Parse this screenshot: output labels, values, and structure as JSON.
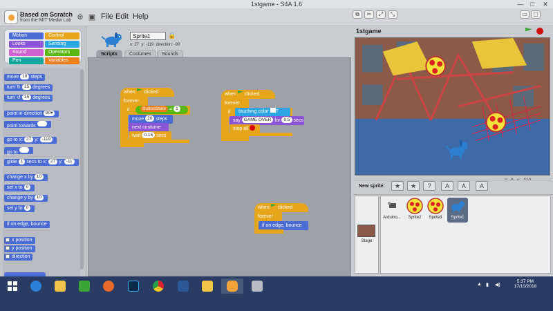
{
  "window": {
    "title": "1stgame - S4A 1.6",
    "minimize": "—",
    "maximize": "□",
    "close": "✕"
  },
  "app": {
    "brand_line1": "Based on Scratch",
    "brand_line2": "from the MIT Media Lab"
  },
  "menu": {
    "items": [
      "File",
      "Edit",
      "Help"
    ]
  },
  "categories": [
    {
      "label": "Motion",
      "color": "#4a6cd4"
    },
    {
      "label": "Control",
      "color": "#e6a51a"
    },
    {
      "label": "Looks",
      "color": "#8a55d7"
    },
    {
      "label": "Sensing",
      "color": "#2ca5e2"
    },
    {
      "label": "Sound",
      "color": "#cf63cf"
    },
    {
      "label": "Operators",
      "color": "#5cb712"
    },
    {
      "label": "Pen",
      "color": "#0fa89b"
    },
    {
      "label": "Variables",
      "color": "#ee7d16"
    }
  ],
  "palette": {
    "move_a": "move",
    "move_v": "10",
    "move_b": "steps",
    "turn_r_a": "turn ↻",
    "turn_r_v": "15",
    "turn_r_b": "degrees",
    "turn_l_a": "turn ↺",
    "turn_l_v": "15",
    "turn_l_b": "degrees",
    "point_dir_a": "point in direction",
    "point_dir_v": "90▾",
    "point_towards": "point towards",
    "goto_xy_a": "go to x:",
    "goto_xy_x": "27",
    "goto_xy_b": "y:",
    "goto_xy_y": "-119",
    "goto": "go to",
    "glide_a": "glide",
    "glide_v": "1",
    "glide_b": "secs to x:",
    "glide_x": "27",
    "glide_c": "y:",
    "glide_y": "-11",
    "change_x_a": "change x by",
    "change_x_v": "10",
    "set_x_a": "set x to",
    "set_x_v": "0",
    "change_y_a": "change y by",
    "change_y_v": "10",
    "set_y_a": "set y to",
    "set_y_v": "0",
    "bounce": "if on edge, bounce",
    "xpos": "x position",
    "ypos": "y position",
    "dir": "direction"
  },
  "sprite": {
    "name": "Sprite1",
    "x_label": "x: 27",
    "y_label": "y: -119",
    "direction_label": "direction: -90"
  },
  "tabs": [
    "Scripts",
    "Costumes",
    "Sounds"
  ],
  "script1": {
    "hat": "when",
    "hat_b": "clicked",
    "forever": "forever",
    "if": "if",
    "var": "ButtonState",
    "eq": "=",
    "eq_v": "1",
    "move_a": "move",
    "move_v": "20",
    "move_b": "steps",
    "next": "next costume",
    "wait_a": "wait",
    "wait_v": "0.15",
    "wait_b": "secs"
  },
  "script2": {
    "hat": "when",
    "hat_b": "clicked",
    "forever": "forever",
    "if": "if",
    "touching": "touching color",
    "touch_color": "#ffffff",
    "touch_q": "?",
    "say_a": "say",
    "say_v": "GAME OVER",
    "say_b": "for",
    "say_secs": "0.5",
    "say_c": "secs",
    "stop": "stop all"
  },
  "script3": {
    "hat": "when",
    "hat_b": "clicked",
    "forever": "forever",
    "bounce": "if on edge, bounce"
  },
  "stage": {
    "title": "1stgame",
    "mouse_x": "x: -8",
    "mouse_y": "y: -410"
  },
  "new_sprite": {
    "label": "New sprite:"
  },
  "sprites": [
    {
      "label": "Arduino..."
    },
    {
      "label": "Sprite2"
    },
    {
      "label": "Sprite3"
    },
    {
      "label": "Sprite1"
    }
  ],
  "stage_label": "Stage",
  "taskbar": {
    "time": "5:37 PM",
    "date": "17/10/2018"
  },
  "colors": {
    "motion": "#4a6cd4",
    "control": "#e6a51a",
    "looks": "#8a55d7",
    "sensing": "#2ca5e2",
    "operators": "#5cb712",
    "taskbar": "#2a3c63"
  }
}
